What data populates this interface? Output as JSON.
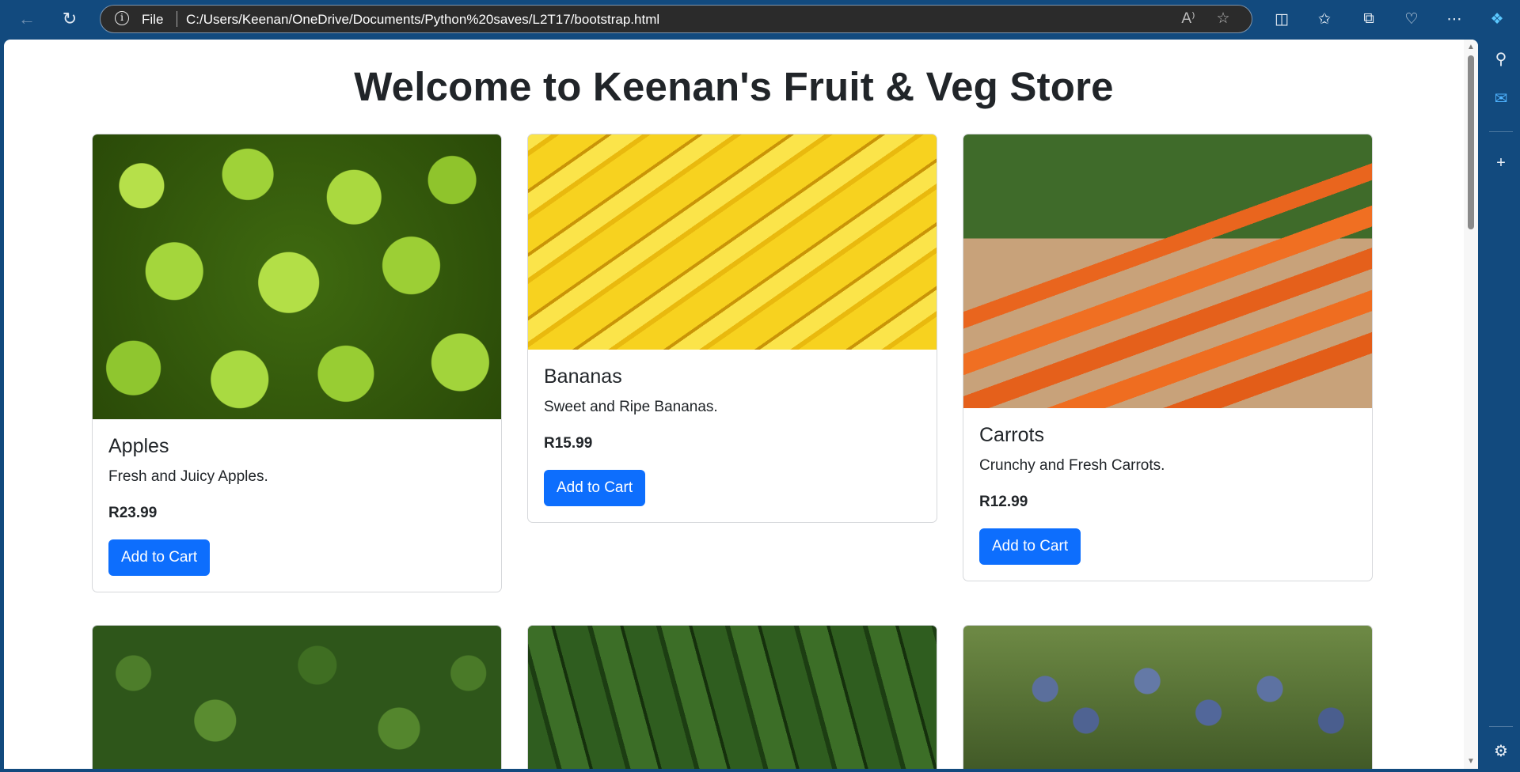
{
  "browser": {
    "scheme_label": "File",
    "url": "C:/Users/Keenan/OneDrive/Documents/Python%20saves/L2T17/bootstrap.html"
  },
  "page": {
    "title": "Welcome to Keenan's Fruit & Veg Store"
  },
  "products": [
    {
      "name": "Apples",
      "description": "Fresh and Juicy Apples.",
      "price": "R23.99",
      "button": "Add to Cart",
      "image": "apples"
    },
    {
      "name": "Bananas",
      "description": "Sweet and Ripe Bananas.",
      "price": "R15.99",
      "button": "Add to Cart",
      "image": "bananas"
    },
    {
      "name": "Carrots",
      "description": "Crunchy and Fresh Carrots.",
      "price": "R12.99",
      "button": "Add to Cart",
      "image": "carrots"
    }
  ],
  "partially_visible_images": [
    "broccoli",
    "cucumbers",
    "grapes"
  ],
  "colors": {
    "button_primary": "#0d6efd",
    "chrome": "#124a7e"
  }
}
